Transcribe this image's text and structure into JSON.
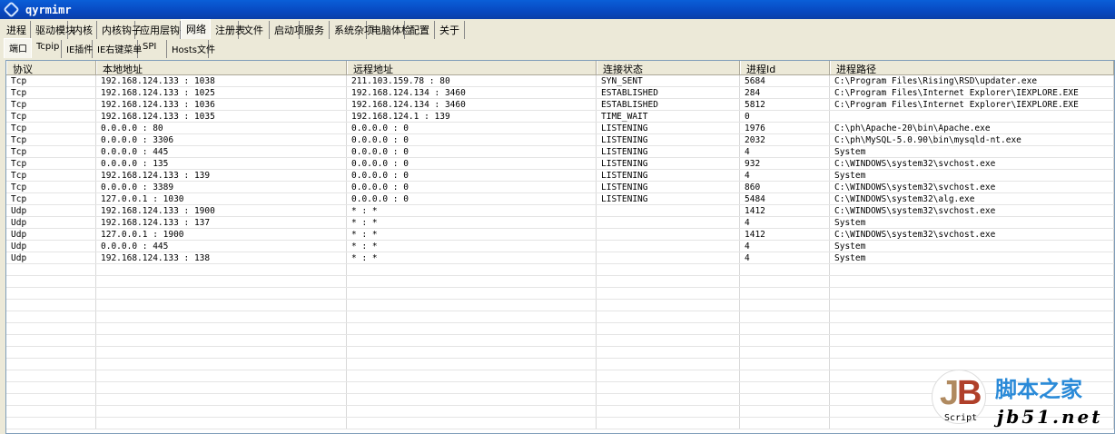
{
  "window": {
    "title": "qyrmimr"
  },
  "main_tabs": [
    "进程",
    "驱动模块",
    "内核",
    "内核钩子",
    "应用层钩子",
    "网络",
    "注册表",
    "文件",
    "启动项",
    "服务",
    "系统杂项",
    "电脑体检",
    "配置",
    "关于"
  ],
  "main_tab_selected": 5,
  "sub_tabs": [
    "端口",
    "Tcpip",
    "IE插件",
    "IE右键菜单",
    "SPI",
    "Hosts文件"
  ],
  "sub_tab_selected": 0,
  "table": {
    "columns": [
      "协议",
      "本地地址",
      "远程地址",
      "连接状态",
      "进程Id",
      "进程路径"
    ],
    "rows": [
      [
        "Tcp",
        "192.168.124.133 : 1038",
        "211.103.159.78 : 80",
        "SYN_SENT",
        "5684",
        "C:\\Program Files\\Rising\\RSD\\updater.exe"
      ],
      [
        "Tcp",
        "192.168.124.133 : 1025",
        "192.168.124.134 : 3460",
        "ESTABLISHED",
        "284",
        "C:\\Program Files\\Internet Explorer\\IEXPLORE.EXE"
      ],
      [
        "Tcp",
        "192.168.124.133 : 1036",
        "192.168.124.134 : 3460",
        "ESTABLISHED",
        "5812",
        "C:\\Program Files\\Internet Explorer\\IEXPLORE.EXE"
      ],
      [
        "Tcp",
        "192.168.124.133 : 1035",
        "192.168.124.1 : 139",
        "TIME_WAIT",
        "0",
        ""
      ],
      [
        "Tcp",
        "0.0.0.0 : 80",
        "0.0.0.0 : 0",
        "LISTENING",
        "1976",
        "C:\\ph\\Apache-20\\bin\\Apache.exe"
      ],
      [
        "Tcp",
        "0.0.0.0 : 3306",
        "0.0.0.0 : 0",
        "LISTENING",
        "2032",
        "C:\\ph\\MySQL-5.0.90\\bin\\mysqld-nt.exe"
      ],
      [
        "Tcp",
        "0.0.0.0 : 445",
        "0.0.0.0 : 0",
        "LISTENING",
        "4",
        "System"
      ],
      [
        "Tcp",
        "0.0.0.0 : 135",
        "0.0.0.0 : 0",
        "LISTENING",
        "932",
        "C:\\WINDOWS\\system32\\svchost.exe"
      ],
      [
        "Tcp",
        "192.168.124.133 : 139",
        "0.0.0.0 : 0",
        "LISTENING",
        "4",
        "System"
      ],
      [
        "Tcp",
        "0.0.0.0 : 3389",
        "0.0.0.0 : 0",
        "LISTENING",
        "860",
        "C:\\WINDOWS\\system32\\svchost.exe"
      ],
      [
        "Tcp",
        "127.0.0.1 : 1030",
        "0.0.0.0 : 0",
        "LISTENING",
        "5484",
        "C:\\WINDOWS\\system32\\alg.exe"
      ],
      [
        "Udp",
        "192.168.124.133 : 1900",
        "* : *",
        "",
        "1412",
        "C:\\WINDOWS\\system32\\svchost.exe"
      ],
      [
        "Udp",
        "192.168.124.133 : 137",
        "* : *",
        "",
        "4",
        "System"
      ],
      [
        "Udp",
        "127.0.0.1 : 1900",
        "* : *",
        "",
        "1412",
        "C:\\WINDOWS\\system32\\svchost.exe"
      ],
      [
        "Udp",
        "0.0.0.0 : 445",
        "* : *",
        "",
        "4",
        "System"
      ],
      [
        "Udp",
        "192.168.124.133 : 138",
        "* : *",
        "",
        "4",
        "System"
      ]
    ]
  },
  "watermark": {
    "logo": "JB Script",
    "name": "脚本之家",
    "url": "jb51.net"
  }
}
